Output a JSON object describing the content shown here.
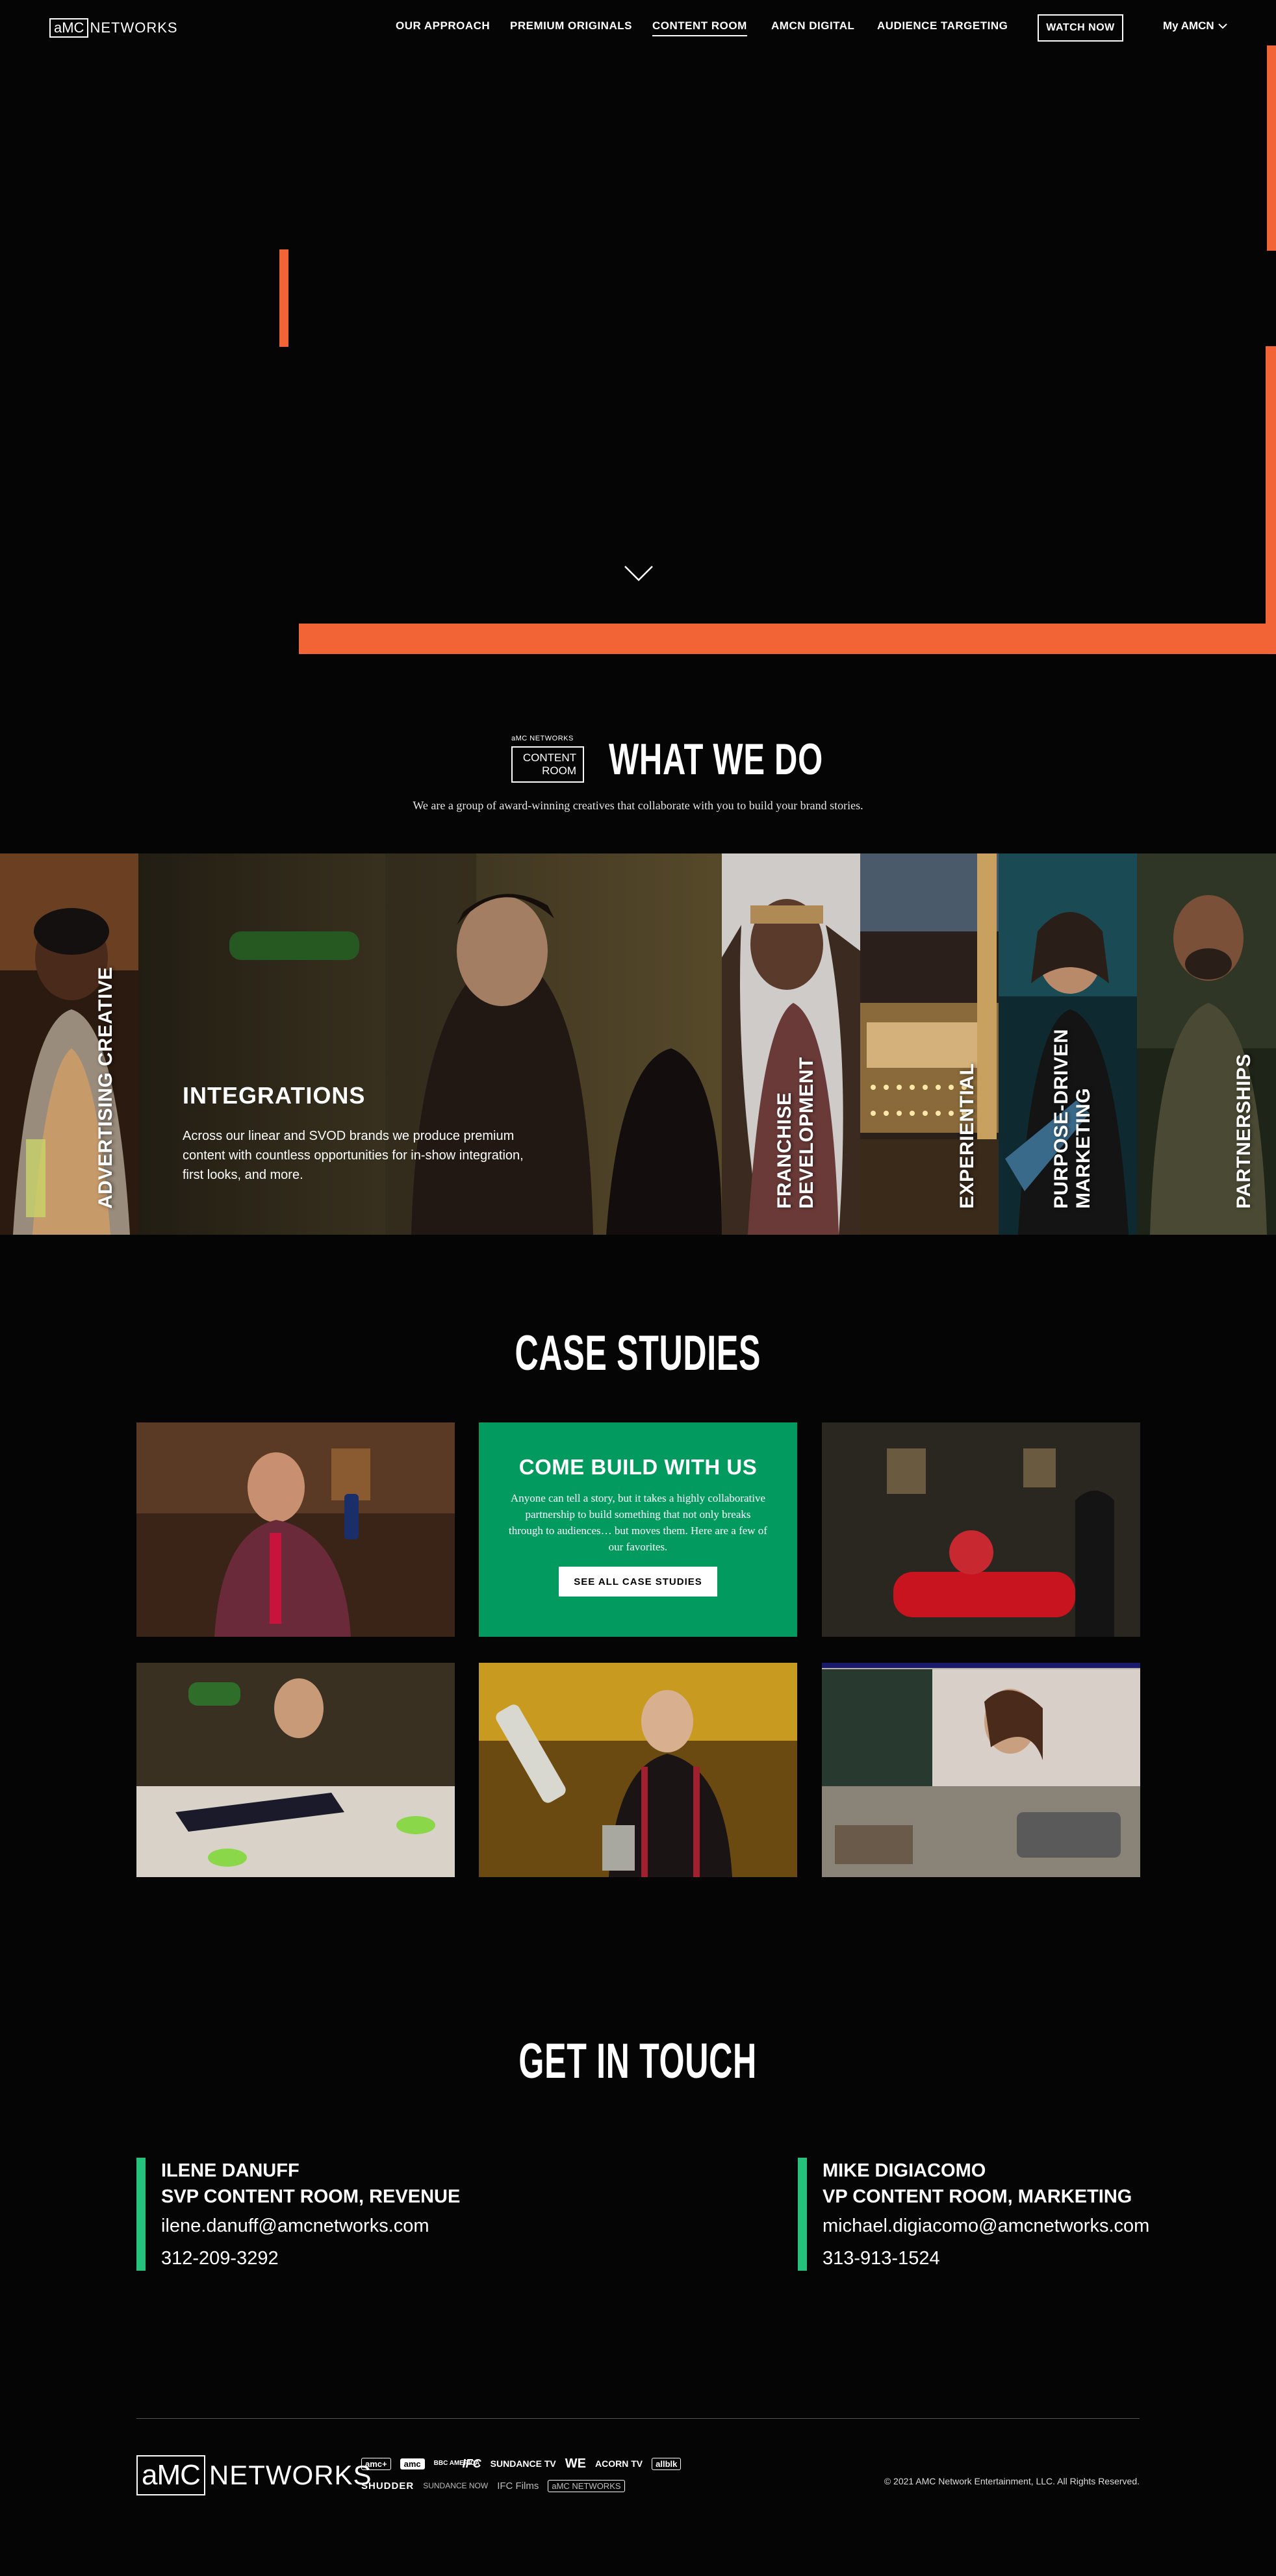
{
  "nav": {
    "logo_box": "aMC",
    "logo_text": "NETWORKS",
    "links": [
      "OUR APPROACH",
      "PREMIUM ORIGINALS",
      "CONTENT ROOM",
      "AMCN DIGITAL",
      "AUDIENCE TARGETING"
    ],
    "active": "CONTENT ROOM",
    "watch_now": "WATCH NOW",
    "my_amcn": "My AMCN"
  },
  "colors": {
    "accent": "#f26335",
    "green": "#039a5f",
    "contact_bar": "#24c27b"
  },
  "what_we_do": {
    "logo_small": "aMC NETWORKS",
    "logo_line1": "CONTENT",
    "logo_line2": "ROOM",
    "title": "WHAT WE DO",
    "subtitle": "We are a group of award-winning creatives that collaborate with you to build your brand stories.",
    "panels": [
      {
        "label": "ADVERTISING CREATIVE"
      },
      {
        "label": "INTEGRATIONS",
        "text": "Across our linear and SVOD brands we produce premium content with countless opportunities for in-show integration, first looks, and more."
      },
      {
        "label_line1": "FRANCHISE",
        "label_line2": "DEVELOPMENT"
      },
      {
        "label": "EXPERIENTIAL"
      },
      {
        "label_line1": "PURPOSE-DRIVEN",
        "label_line2": "MARKETING"
      },
      {
        "label": "PARTNERSHIPS"
      }
    ]
  },
  "case_studies": {
    "title": "CASE STUDIES",
    "build_title": "COME BUILD WITH US",
    "build_text": "Anyone can tell a story, but it takes a highly collaborative partnership to build something that not only breaks through to audiences… but moves them. Here are a few of our favorites.",
    "build_button": "SEE ALL CASE STUDIES"
  },
  "get_in_touch": {
    "title": "GET IN TOUCH",
    "contacts": [
      {
        "name": "ILENE DANUFF",
        "role": "SVP CONTENT ROOM, REVENUE",
        "email": "ilene.danuff@amcnetworks.com",
        "phone": "312-209-3292"
      },
      {
        "name": "MIKE DIGIACOMO",
        "role": "VP CONTENT ROOM, MARKETING",
        "email": "michael.digiacomo@amcnetworks.com",
        "phone": "313-913-1524"
      }
    ]
  },
  "footer": {
    "logo_box": "aMC",
    "logo_text": "NETWORKS",
    "brands_row1": [
      "amc+",
      "amc",
      "BBC AMERICA",
      "IFC",
      "SUNDANCE TV",
      "WE",
      "ACORN TV",
      "allblk"
    ],
    "brands_row2": [
      "SHUDDER",
      "SUNDANCE NOW",
      "IFC Films",
      "aMC NETWORKS"
    ],
    "copyright": "© 2021 AMC Network Entertainment, LLC. All Rights Reserved."
  }
}
